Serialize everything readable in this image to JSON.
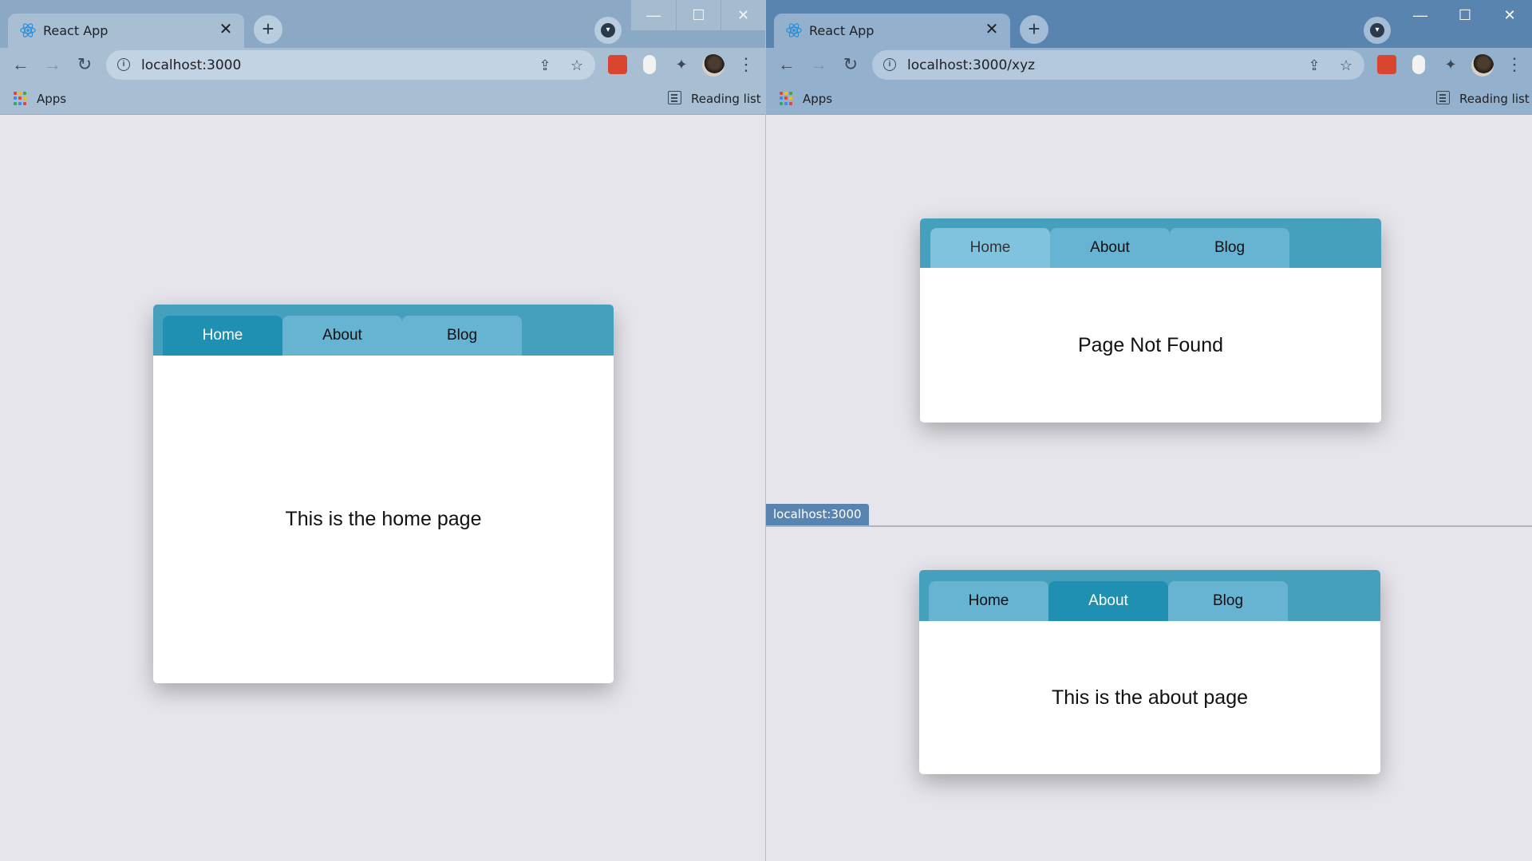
{
  "left_window": {
    "tab_title": "React App",
    "url": "localhost:3000",
    "bookmarks": {
      "apps_label": "Apps",
      "reading_list_label": "Reading list"
    },
    "window_controls": {
      "minimize": "—",
      "maximize": "☐",
      "close": "✕"
    },
    "card": {
      "tabs": [
        {
          "label": "Home",
          "state": "active"
        },
        {
          "label": "About",
          "state": "normal"
        },
        {
          "label": "Blog",
          "state": "normal"
        }
      ],
      "content": "This is the home page"
    }
  },
  "right_window": {
    "tab_title": "React App",
    "url": "localhost:3000/xyz",
    "bookmarks": {
      "apps_label": "Apps",
      "reading_list_label": "Reading list"
    },
    "window_controls": {
      "minimize": "—",
      "maximize": "☐",
      "close": "✕"
    },
    "status_bubble": "localhost:3000",
    "card": {
      "tabs": [
        {
          "label": "Home",
          "state": "hover"
        },
        {
          "label": "About",
          "state": "normal"
        },
        {
          "label": "Blog",
          "state": "normal"
        }
      ],
      "content": "Page Not Found"
    }
  },
  "bottom_window": {
    "card": {
      "tabs": [
        {
          "label": "Home",
          "state": "normal"
        },
        {
          "label": "About",
          "state": "active"
        },
        {
          "label": "Blog",
          "state": "normal"
        }
      ],
      "content": "This is the about page"
    }
  },
  "icons": {
    "tab_close": "✕",
    "new_tab": "+",
    "back": "←",
    "forward": "→",
    "reload": "↻",
    "info": "i",
    "share": "⇪",
    "star": "☆",
    "extensions": "✦",
    "menu": "⋮",
    "tab_search": "▾"
  },
  "colors": {
    "card_header": "#45a0bd",
    "tab_normal": "#67b3d2",
    "tab_active": "#2090b2",
    "tab_hover": "#7fc3df",
    "page_background": "#e6e5eb"
  }
}
